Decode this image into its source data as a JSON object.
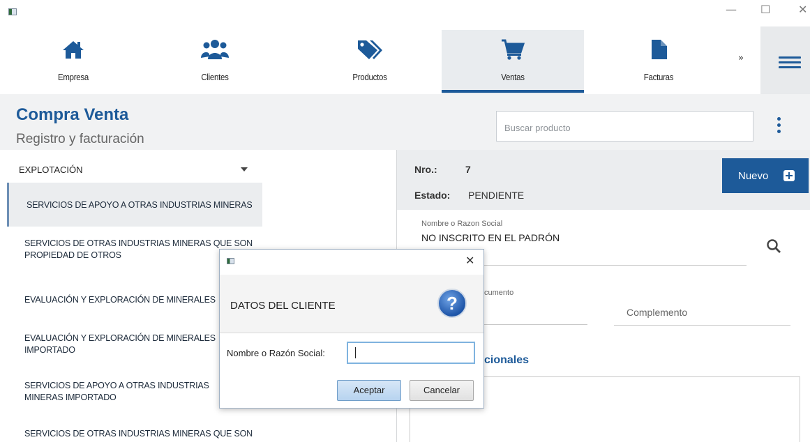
{
  "window": {
    "minimize": "—",
    "maximize": "☐",
    "close": "✕"
  },
  "nav": {
    "items": [
      {
        "label": "Empresa",
        "icon": "home-icon"
      },
      {
        "label": "Clientes",
        "icon": "users-icon"
      },
      {
        "label": "Productos",
        "icon": "tag-icon"
      },
      {
        "label": "Ventas",
        "icon": "cart-icon"
      },
      {
        "label": "Facturas",
        "icon": "document-icon"
      }
    ],
    "active": "Ventas",
    "more": "»"
  },
  "header": {
    "title": "Compra Venta",
    "subtitle": "Registro y facturación",
    "search_placeholder": "Buscar producto"
  },
  "sidebar": {
    "combo_value": "EXPLOTACIÓN",
    "items": [
      "SERVICIOS DE APOYO A OTRAS INDUSTRIAS MINERAS",
      "SERVICIOS DE OTRAS INDUSTRIAS MINERAS QUE SON PROPIEDAD DE OTROS",
      "EVALUACIÓN Y EXPLORACIÓN DE MINERALES",
      "EVALUACIÓN Y EXPLORACIÓN DE MINERALES IMPORTADO",
      "SERVICIOS DE APOYO A OTRAS INDUSTRIAS MINERAS IMPORTADO",
      "SERVICIOS DE OTRAS INDUSTRIAS MINERAS QUE SON"
    ],
    "selected_index": 0
  },
  "detail": {
    "nro_label": "Nro.:",
    "nro_value": "7",
    "estado_label": "Estado:",
    "estado_value": "PENDIENTE",
    "nuevo_label": "Nuevo",
    "nombre_label": "Nombre o Razon Social",
    "nombre_value": "NO INSCRITO EN EL PADRÓN",
    "documento_label_fragment": "cumento",
    "complemento_placeholder": "Complemento",
    "section_fragment": "cionales"
  },
  "dialog": {
    "title": "DATOS DEL CLIENTE",
    "field_label": "Nombre o Razón Social:",
    "field_value": "",
    "ok_label": "Aceptar",
    "cancel_label": "Cancelar",
    "close": "✕",
    "question_glyph": "?"
  },
  "colors": {
    "accent": "#1d5a99",
    "header_bg": "#f1f2f3",
    "selected_bg": "#ebedef"
  }
}
